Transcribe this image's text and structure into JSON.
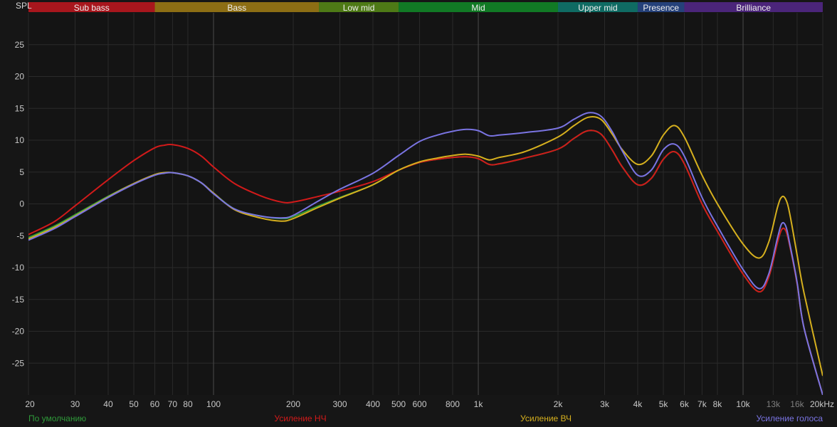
{
  "chart_data": {
    "type": "line",
    "ylabel": "SPL",
    "ylim": [
      -30,
      30
    ],
    "xlim": [
      20,
      20000
    ],
    "x_scale": "log",
    "grid": true,
    "y_ticks": [
      25,
      20,
      15,
      10,
      5,
      0,
      -5,
      -10,
      -15,
      -20,
      -25
    ],
    "x_ticks": [
      {
        "value": 20,
        "label": "20",
        "muted": false
      },
      {
        "value": 30,
        "label": "30",
        "muted": false
      },
      {
        "value": 40,
        "label": "40",
        "muted": false
      },
      {
        "value": 50,
        "label": "50",
        "muted": false
      },
      {
        "value": 60,
        "label": "60",
        "muted": false
      },
      {
        "value": 70,
        "label": "70",
        "muted": false
      },
      {
        "value": 80,
        "label": "80",
        "muted": false
      },
      {
        "value": 100,
        "label": "100",
        "muted": false
      },
      {
        "value": 200,
        "label": "200",
        "muted": false
      },
      {
        "value": 300,
        "label": "300",
        "muted": false
      },
      {
        "value": 400,
        "label": "400",
        "muted": false
      },
      {
        "value": 500,
        "label": "500",
        "muted": false
      },
      {
        "value": 600,
        "label": "600",
        "muted": false
      },
      {
        "value": 800,
        "label": "800",
        "muted": false
      },
      {
        "value": 1000,
        "label": "1k",
        "muted": false
      },
      {
        "value": 2000,
        "label": "2k",
        "muted": false
      },
      {
        "value": 3000,
        "label": "3k",
        "muted": false
      },
      {
        "value": 4000,
        "label": "4k",
        "muted": false
      },
      {
        "value": 5000,
        "label": "5k",
        "muted": false
      },
      {
        "value": 6000,
        "label": "6k",
        "muted": false
      },
      {
        "value": 7000,
        "label": "7k",
        "muted": false
      },
      {
        "value": 8000,
        "label": "8k",
        "muted": false
      },
      {
        "value": 10000,
        "label": "10k",
        "muted": false
      },
      {
        "value": 13000,
        "label": "13k",
        "muted": true
      },
      {
        "value": 16000,
        "label": "16k",
        "muted": true
      },
      {
        "value": 20000,
        "label": "20kHz",
        "muted": false
      }
    ],
    "bands": [
      {
        "name": "Sub bass",
        "from": 20,
        "to": 60,
        "color": "#a8161d"
      },
      {
        "name": "Bass",
        "from": 60,
        "to": 250,
        "color": "#8d6e14"
      },
      {
        "name": "Low mid",
        "from": 250,
        "to": 500,
        "color": "#4e7a16"
      },
      {
        "name": "Mid",
        "from": 500,
        "to": 2000,
        "color": "#117a25"
      },
      {
        "name": "Upper mid",
        "from": 2000,
        "to": 4000,
        "color": "#0f6b63"
      },
      {
        "name": "Presence",
        "from": 4000,
        "to": 6000,
        "color": "#25417a"
      },
      {
        "name": "Brilliance",
        "from": 6000,
        "to": 20000,
        "color": "#4b257a"
      }
    ],
    "series": [
      {
        "name": "По умолчанию",
        "color": "#2f9a3a",
        "x": [
          20,
          25,
          30,
          40,
          50,
          60,
          65,
          70,
          80,
          90,
          100,
          120,
          150,
          180,
          200,
          250,
          300,
          400,
          500,
          600,
          700,
          800,
          900,
          1000,
          1100,
          1200,
          1500,
          2000,
          2300,
          2600,
          2900,
          3200,
          3500,
          4000,
          4500,
          5000,
          5500,
          6000,
          7000,
          8000,
          10000,
          11500,
          12500,
          13500,
          14000,
          14500,
          15000,
          16000,
          17000,
          20000
        ],
        "values": [
          -5.3,
          -3.5,
          -1.7,
          1.2,
          3.2,
          4.6,
          4.9,
          4.9,
          4.4,
          3.3,
          1.7,
          -0.8,
          -1.9,
          -2.3,
          -2.0,
          -0.3,
          1.0,
          3.0,
          5.3,
          6.5,
          7.0,
          7.3,
          7.4,
          7.1,
          6.2,
          6.3,
          7.2,
          8.6,
          10.3,
          11.5,
          11.0,
          8.5,
          5.8,
          3.0,
          4.0,
          7.0,
          8.2,
          6.3,
          0.0,
          -4.3,
          -11.0,
          -13.8,
          -11.5,
          -6.0,
          -4.0,
          -4.2,
          -6.5,
          -12.5,
          -19.5,
          -30.0
        ]
      },
      {
        "name": "Усиление НЧ",
        "color": "#d11a1a",
        "x": [
          20,
          25,
          30,
          40,
          50,
          60,
          65,
          70,
          80,
          90,
          100,
          120,
          150,
          180,
          200,
          250,
          300,
          400,
          500,
          600,
          700,
          800,
          900,
          1000,
          1100,
          1200,
          1500,
          2000,
          2300,
          2600,
          2900,
          3200,
          3500,
          4000,
          4500,
          5000,
          5500,
          6000,
          7000,
          8000,
          10000,
          11500,
          12500,
          13500,
          14000,
          14500,
          15000,
          16000,
          17000,
          20000
        ],
        "values": [
          -4.8,
          -2.8,
          -0.3,
          3.8,
          6.8,
          8.8,
          9.2,
          9.3,
          8.7,
          7.5,
          5.8,
          3.2,
          1.3,
          0.3,
          0.3,
          1.2,
          2.0,
          3.5,
          5.3,
          6.5,
          7.0,
          7.3,
          7.4,
          7.1,
          6.2,
          6.3,
          7.2,
          8.6,
          10.3,
          11.5,
          11.0,
          8.5,
          5.8,
          3.0,
          4.0,
          7.0,
          8.2,
          6.3,
          0.0,
          -4.3,
          -11.0,
          -13.8,
          -11.5,
          -6.0,
          -4.0,
          -4.2,
          -6.5,
          -12.5,
          -19.5,
          -30.0
        ]
      },
      {
        "name": "Усиление ВЧ",
        "color": "#d6b01e",
        "x": [
          20,
          25,
          30,
          40,
          50,
          60,
          65,
          70,
          80,
          90,
          100,
          120,
          150,
          180,
          200,
          250,
          300,
          400,
          500,
          600,
          700,
          800,
          900,
          1000,
          1100,
          1200,
          1500,
          2000,
          2300,
          2600,
          2900,
          3200,
          3500,
          4000,
          4500,
          5000,
          5500,
          6000,
          7000,
          8000,
          10000,
          11500,
          12500,
          13500,
          14000,
          14500,
          15000,
          16000,
          17000,
          20000
        ],
        "values": [
          -5.5,
          -3.7,
          -1.9,
          1.1,
          3.2,
          4.6,
          4.9,
          4.9,
          4.4,
          3.3,
          1.7,
          -0.9,
          -2.2,
          -2.7,
          -2.3,
          -0.5,
          0.9,
          3.0,
          5.3,
          6.6,
          7.2,
          7.6,
          7.8,
          7.5,
          6.9,
          7.3,
          8.2,
          10.5,
          12.3,
          13.6,
          13.3,
          11.0,
          8.5,
          6.2,
          7.5,
          10.8,
          12.3,
          10.5,
          4.5,
          0.0,
          -6.3,
          -8.5,
          -6.0,
          -0.5,
          1.1,
          0.7,
          -1.5,
          -8.0,
          -14.0,
          -27.0
        ]
      },
      {
        "name": "Усиление голоса",
        "color": "#7a74e2",
        "x": [
          20,
          25,
          30,
          40,
          50,
          60,
          65,
          70,
          80,
          90,
          100,
          120,
          150,
          180,
          200,
          250,
          300,
          400,
          500,
          600,
          700,
          800,
          900,
          1000,
          1100,
          1200,
          1500,
          2000,
          2300,
          2600,
          2900,
          3200,
          3500,
          4000,
          4500,
          5000,
          5500,
          6000,
          7000,
          8000,
          10000,
          11500,
          12500,
          13500,
          14000,
          14500,
          15000,
          16000,
          17000,
          20000
        ],
        "values": [
          -5.7,
          -3.9,
          -2.0,
          1.0,
          3.1,
          4.5,
          4.8,
          4.9,
          4.4,
          3.3,
          1.6,
          -0.8,
          -1.9,
          -2.2,
          -1.8,
          0.5,
          2.3,
          4.8,
          7.6,
          9.8,
          10.8,
          11.4,
          11.7,
          11.5,
          10.7,
          10.8,
          11.2,
          11.9,
          13.3,
          14.3,
          13.8,
          11.4,
          8.3,
          4.5,
          5.3,
          8.5,
          9.4,
          7.5,
          1.0,
          -3.5,
          -10.3,
          -13.3,
          -11.0,
          -5.3,
          -3.1,
          -3.5,
          -6.2,
          -12.3,
          -19.5,
          -30.0
        ]
      }
    ]
  }
}
